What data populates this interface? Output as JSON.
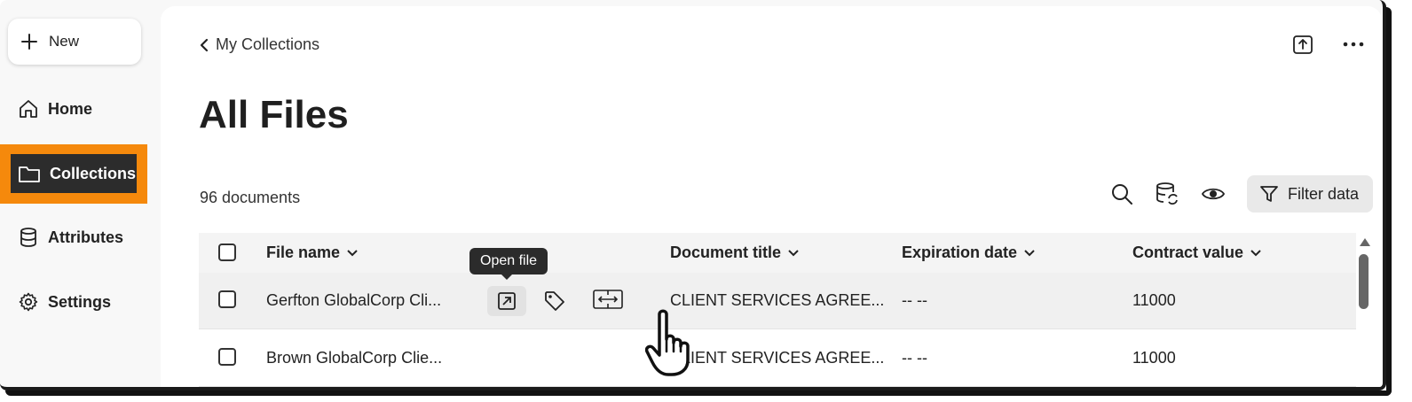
{
  "sidebar": {
    "new_label": "New",
    "items": [
      {
        "label": "Home",
        "icon": "home-icon"
      },
      {
        "label": "Collections",
        "icon": "folder-icon",
        "active": true
      },
      {
        "label": "Attributes",
        "icon": "database-icon"
      },
      {
        "label": "Settings",
        "icon": "gear-icon"
      }
    ]
  },
  "header": {
    "breadcrumb": "My Collections",
    "title": "All Files",
    "count": "96 documents"
  },
  "toolbar": {
    "filter_label": "Filter data"
  },
  "table": {
    "columns": [
      "File name",
      "Document title",
      "Expiration date",
      "Contract value"
    ],
    "rows": [
      {
        "file_name": "Gerfton GlobalCorp Cli...",
        "document_title": "CLIENT SERVICES AGREE...",
        "expiration_date": "-- --",
        "contract_value": "11000"
      },
      {
        "file_name": "Brown GlobalCorp Clie...",
        "document_title": "CLIENT SERVICES AGREE...",
        "expiration_date": "-- --",
        "contract_value": "11000"
      }
    ]
  },
  "tooltip": "Open file",
  "colors": {
    "highlight": "#f5890c",
    "active_nav": "#2c2c2c"
  }
}
